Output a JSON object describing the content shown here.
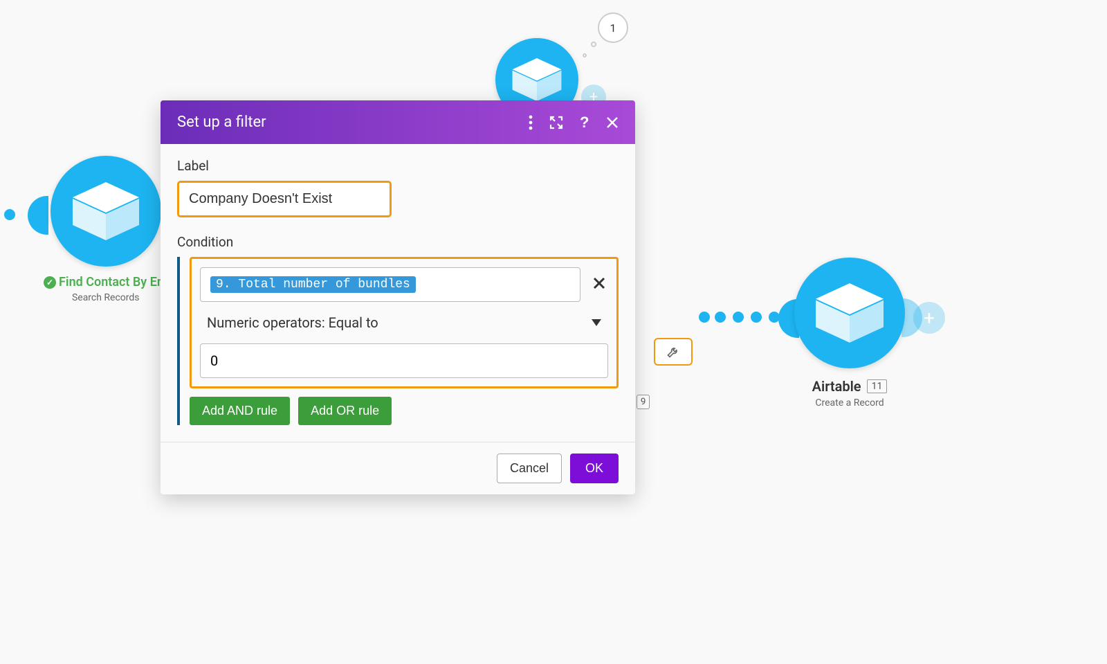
{
  "canvas": {
    "top_bubble_count": "1",
    "left_node": {
      "label": "Find Contact By Em",
      "sublabel": "Search Records"
    },
    "right_node": {
      "title": "Airtable",
      "count": "11",
      "action": "Create a Record"
    },
    "side_badge": "9"
  },
  "modal": {
    "title": "Set up a filter",
    "label_section": "Label",
    "label_value": "Company Doesn't Exist",
    "condition_section": "Condition",
    "condition_token": "9. Total number of bundles",
    "operator": "Numeric operators: Equal to",
    "value": "0",
    "add_and": "Add AND rule",
    "add_or": "Add OR rule",
    "cancel": "Cancel",
    "ok": "OK"
  }
}
